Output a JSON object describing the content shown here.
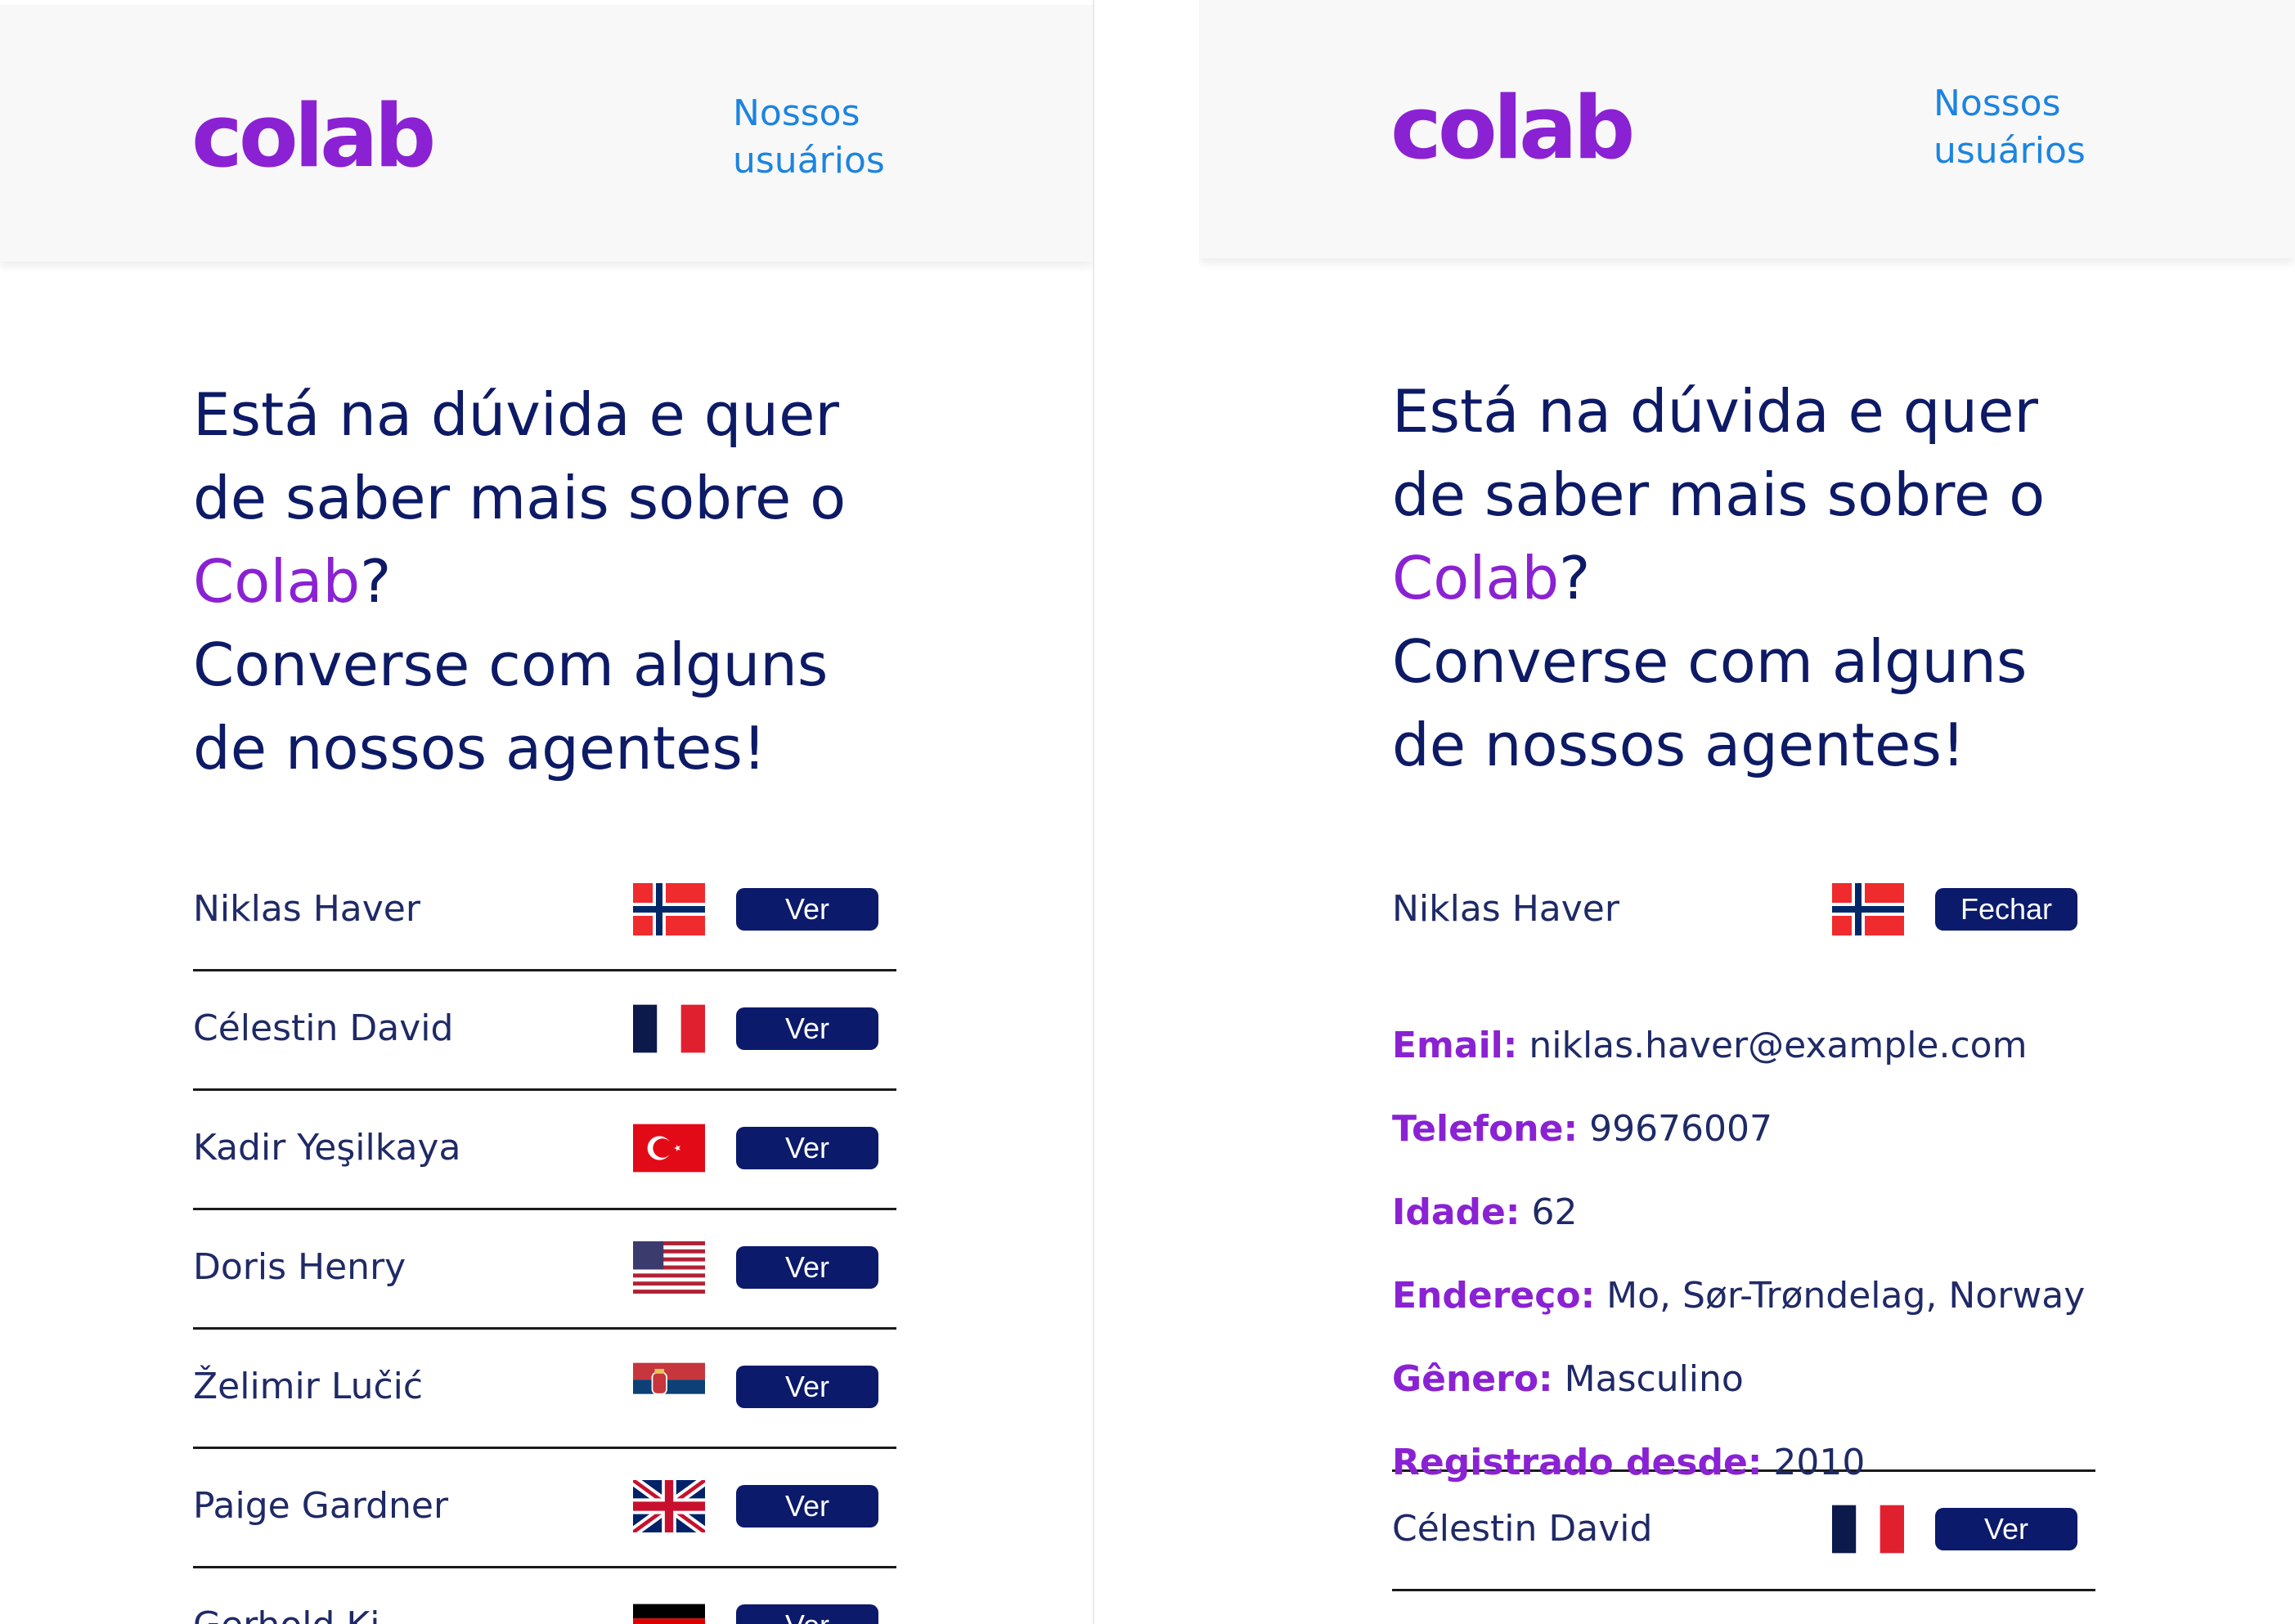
{
  "brand": {
    "logo_text": "colab",
    "nav_link": "Nossos usuários",
    "color_primary": "#8a22d3",
    "color_navy": "#0b1a6b",
    "color_link": "#1c84e0"
  },
  "headline": {
    "line1": "Está na dúvida e quer de saber mais sobre o",
    "brand_word": "Colab",
    "question_mark": "?",
    "line2": "Converse com alguns de nossos agentes!"
  },
  "left_screen": {
    "agents": [
      {
        "name": "Niklas Haver",
        "flag_icon": "norway-flag-icon",
        "button": "Ver"
      },
      {
        "name": "Célestin David",
        "flag_icon": "france-flag-icon",
        "button": "Ver"
      },
      {
        "name": "Kadir Yeşilkaya",
        "flag_icon": "turkey-flag-icon",
        "button": "Ver"
      },
      {
        "name": "Doris Henry",
        "flag_icon": "usa-flag-icon",
        "button": "Ver"
      },
      {
        "name": "Želimir Lučić",
        "flag_icon": "serbia-flag-icon",
        "button": "Ver"
      },
      {
        "name": "Paige Gardner",
        "flag_icon": "uk-flag-icon",
        "button": "Ver"
      },
      {
        "name": "Gerhold Ki...",
        "flag_icon": "germany-flag-icon",
        "button": "Ver"
      }
    ]
  },
  "right_screen": {
    "expanded_agent": {
      "name": "Niklas Haver",
      "flag_icon": "norway-flag-icon",
      "button": "Fechar",
      "details": [
        {
          "label": "Email:",
          "value": "niklas.haver@example.com"
        },
        {
          "label": "Telefone:",
          "value": "99676007"
        },
        {
          "label": "Idade:",
          "value": "62"
        },
        {
          "label": "Endereço:",
          "value": "Mo, Sør-Trøndelag, Norway"
        },
        {
          "label": "Gênero:",
          "value": "Masculino"
        },
        {
          "label": "Registrado desde:",
          "value": "2010"
        }
      ]
    },
    "next_agent": {
      "name": "Célestin David",
      "flag_icon": "france-flag-icon",
      "button": "Ver"
    }
  }
}
